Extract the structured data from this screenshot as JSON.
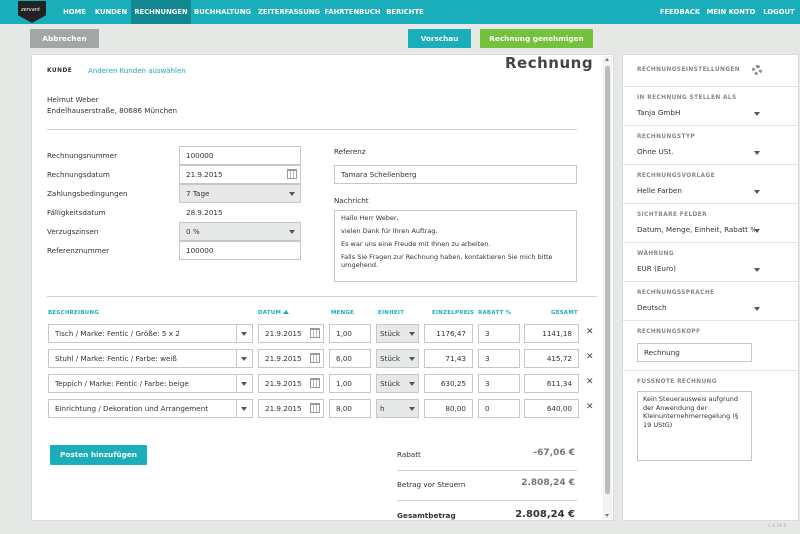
{
  "nav": {
    "logo": "zervant",
    "items": [
      "HOME",
      "KUNDEN",
      "RECHNUNGEN",
      "BUCHHALTUNG",
      "ZEITERFASSUNG",
      "FAHRTENBUCH",
      "BERICHTE"
    ],
    "right": [
      "FEEDBACK",
      "MEIN KONTO",
      "LOGOUT"
    ],
    "active_index": 2
  },
  "toolbar": {
    "cancel": "Abbrechen",
    "preview": "Vorschau",
    "approve": "Rechnung genehmigen"
  },
  "invoice": {
    "title": "Rechnung",
    "customer_label": "KUNDE",
    "other_customer_link": "Anderen Kunden auswählen",
    "customer_name": "Helmut Weber",
    "customer_address": "Endelhauserstraße, 80686 München",
    "fields": {
      "number_label": "Rechnungsnummer",
      "number_value": "100000",
      "date_label": "Rechnungsdatum",
      "date_value": "21.9.2015",
      "terms_label": "Zahlungsbedingungen",
      "terms_value": "7 Tage",
      "due_label": "Fälligkeitsdatum",
      "due_value": "28.9.2015",
      "interest_label": "Verzugszinsen",
      "interest_value": "0 %",
      "ref_number_label": "Referenznummer",
      "ref_number_value": "100000"
    },
    "reference_label": "Referenz",
    "reference_value": "Tamara Schellenberg",
    "message_label": "Nachricht",
    "message_lines": [
      "Hallo Herr Weber,",
      "vielen Dank für Ihren Auftrag.",
      "Es war uns eine Freude mit Ihnen zu arbeiten.",
      "Falls Sie Fragen zur Rechnung haben, kontaktieren Sie mich bitte",
      "umgehend."
    ],
    "columns": {
      "description": "BESCHREIBUNG",
      "date": "DATUM",
      "qty": "MENGE",
      "unit": "EINHEIT",
      "price": "EINZELPREIS",
      "discount": "RABATT %",
      "total": "GESAMT"
    },
    "rows": [
      {
        "description": "Tisch / Marke: Fentic / Größe: 5 x 2",
        "date": "21.9.2015",
        "qty": "1,00",
        "unit": "Stück",
        "price": "1176,47",
        "discount": "3",
        "total": "1141,18"
      },
      {
        "description": "Stuhl / Marke: Fentic / Farbe: weiß",
        "date": "21.9.2015",
        "qty": "6,00",
        "unit": "Stück",
        "price": "71,43",
        "discount": "3",
        "total": "415,72"
      },
      {
        "description": "Teppich / Marke: Fentic / Farbe: beige",
        "date": "21.9.2015",
        "qty": "1,00",
        "unit": "Stück",
        "price": "630,25",
        "discount": "3",
        "total": "611,34"
      },
      {
        "description": "Einrichtung / Dekoration und Arrangement",
        "date": "21.9.2015",
        "qty": "8,00",
        "unit": "h",
        "price": "80,00",
        "discount": "0",
        "total": "640,00"
      }
    ],
    "add_button": "Posten hinzufügen",
    "totals": [
      {
        "label": "Rabatt",
        "value": "-67,06 €"
      },
      {
        "label": "Betrag vor Steuern",
        "value": "2.808,24 €"
      },
      {
        "label": "Gesamtbetrag",
        "value": "2.808,24 €"
      }
    ]
  },
  "settings": {
    "title": "RECHNUNGSEINSTELLUNGEN",
    "sections": [
      {
        "label": "IN RECHNUNG STELLEN ALS",
        "value": "Tanja GmbH"
      },
      {
        "label": "RECHNUNGSTYP",
        "value": "Ohne USt."
      },
      {
        "label": "RECHNUNGSVORLAGE",
        "value": "Helle Farben"
      },
      {
        "label": "SICHTBARE FELDER",
        "value": "Datum, Menge, Einheit, Rabatt %, E..."
      },
      {
        "label": "WÄHRUNG",
        "value": "EUR (Euro)"
      },
      {
        "label": "RECHNUNGSSPRACHE",
        "value": "Deutsch"
      }
    ],
    "head_label": "RECHNUNGSKOPF",
    "head_value": "Rechnung",
    "footnote_label": "FUSSNOTE RECHNUNG",
    "footnote_value": "Kein Steuerausweis aufgrund der Anwendung der Kleinunternehmerregelung (§ 19 UStG)"
  },
  "version": "v 4.16.0"
}
